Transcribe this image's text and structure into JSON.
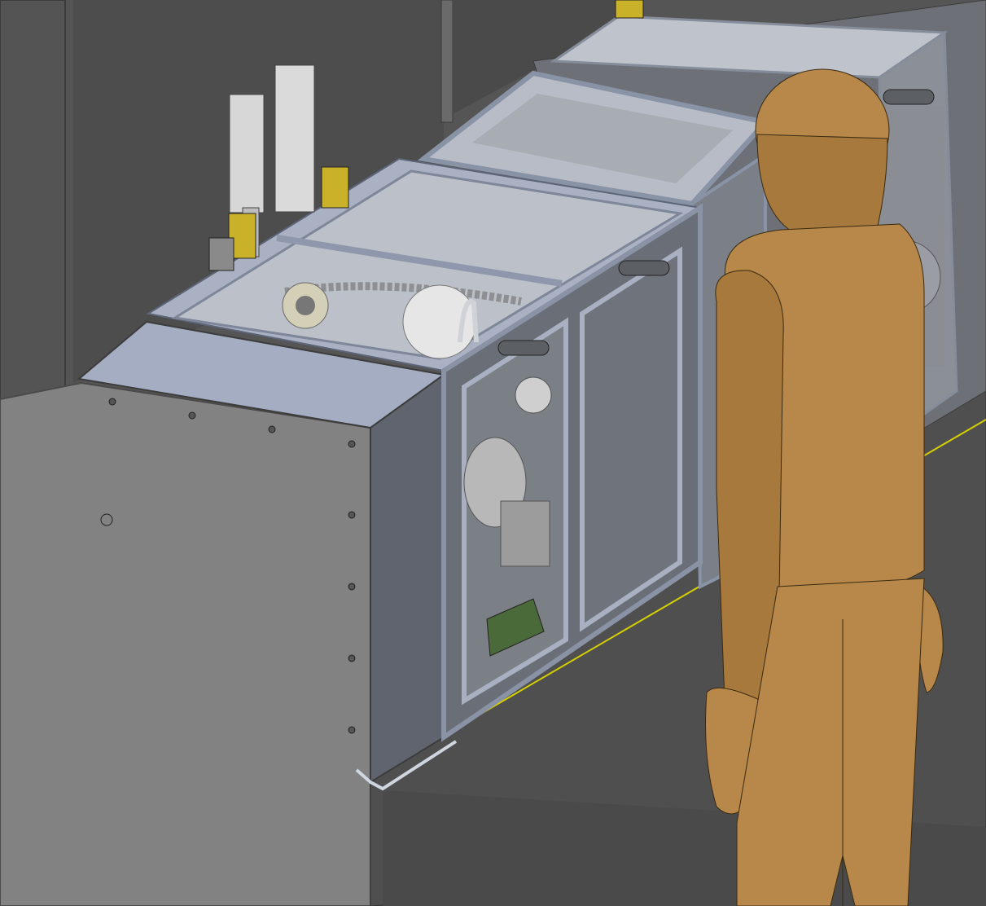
{
  "scene": {
    "kind": "cad-assembly-view",
    "components": [
      "wall-panel-left",
      "wall-post",
      "base-cabinet",
      "top-cover-plate",
      "enclosure-frame-front",
      "enclosure-frame-back",
      "glass-panel",
      "chain-drive",
      "sprocket",
      "motor-drum",
      "cable",
      "door-handle",
      "safety-interlock-switch",
      "bracket",
      "human-mannequin"
    ],
    "colors": {
      "background": "#5a5a5a",
      "wall": "#4d4d4d",
      "cabinet": "#828282",
      "cabinet_side": "#6b6d70",
      "frame": "#a9b1c3",
      "frame_dark": "#8a93a6",
      "glass": "#c9ccd2",
      "bracket": "#c9b22a",
      "switch": "#d7d7d7",
      "handle": "#5c5f63",
      "mannequin": "#b7884a",
      "mannequin_shadow": "#96692f",
      "edge_highlight": "#d6d000"
    }
  }
}
